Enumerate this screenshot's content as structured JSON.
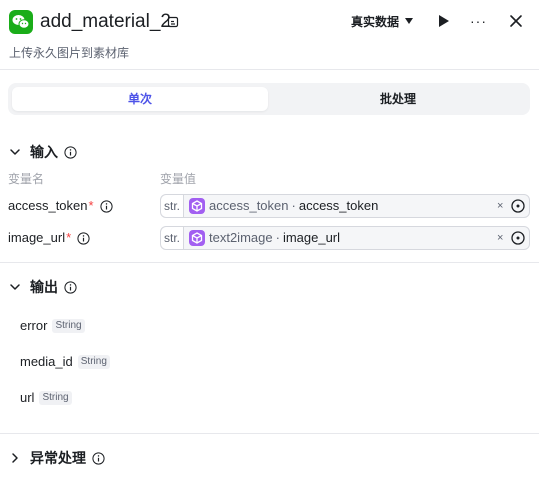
{
  "header": {
    "title": "add_material_2",
    "subtitle": "上传永久图片到素材库",
    "mode_label": "真实数据",
    "more_label": "···",
    "app_icon": "wechat-icon"
  },
  "tabs": {
    "single": "单次",
    "batch": "批处理"
  },
  "input": {
    "title": "输入",
    "col_name": "变量名",
    "col_value": "变量值",
    "rows": [
      {
        "name": "access_token",
        "required": "*",
        "type": "str.",
        "source": "access_token",
        "separator": "·",
        "variable": "access_token",
        "clear": "×"
      },
      {
        "name": "image_url",
        "required": "*",
        "type": "str.",
        "source": "text2image",
        "separator": "·",
        "variable": "image_url",
        "clear": "×"
      }
    ]
  },
  "output": {
    "title": "输出",
    "items": [
      {
        "name": "error",
        "type": "String"
      },
      {
        "name": "media_id",
        "type": "String"
      },
      {
        "name": "url",
        "type": "String"
      }
    ]
  },
  "exception": {
    "title": "异常处理"
  },
  "colors": {
    "accent": "#4d53e8",
    "node_icon": "#a25ff1",
    "wechat": "#1aad19",
    "required": "#f53f3f"
  }
}
